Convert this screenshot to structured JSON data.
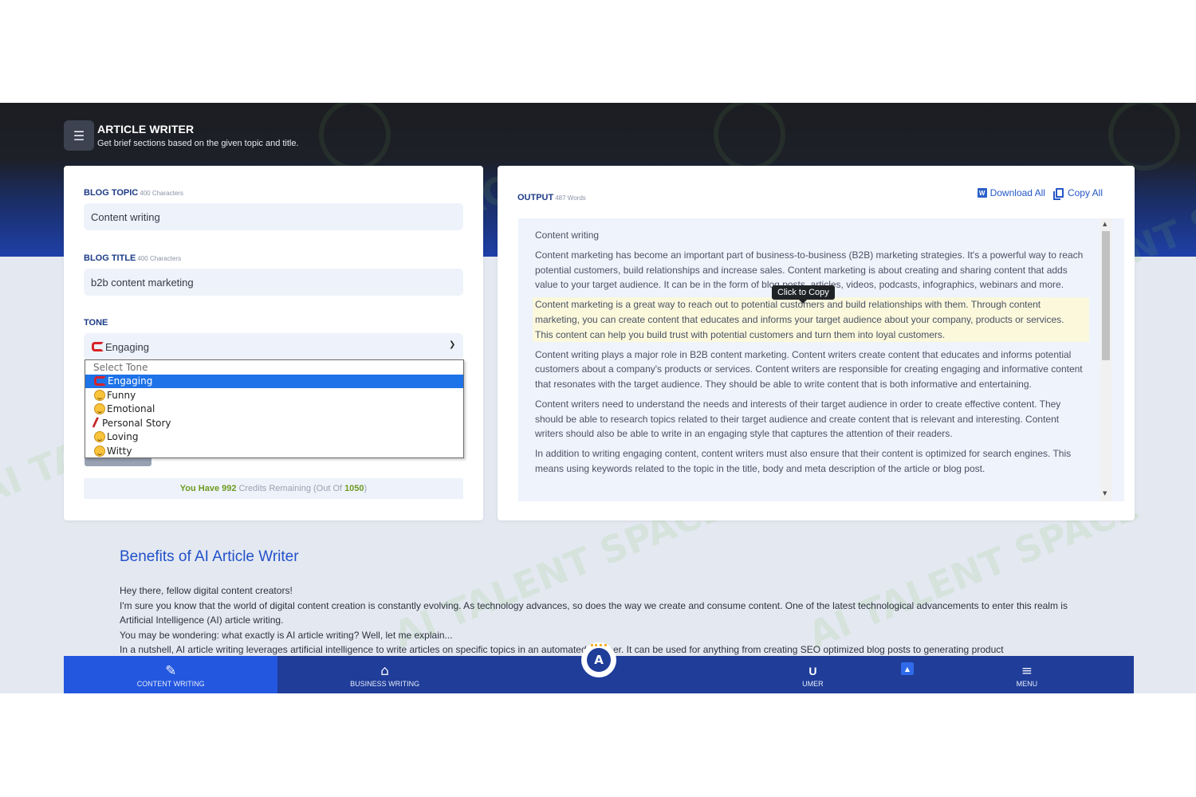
{
  "header": {
    "title": "ARTICLE WRITER",
    "subtitle": "Get brief sections based on the given topic and title.",
    "icon": "article-list-icon"
  },
  "form": {
    "blog_topic": {
      "label": "BLOG TOPIC",
      "hint": "400 Characters",
      "value": "Content writing"
    },
    "blog_title": {
      "label": "BLOG TITLE",
      "hint": "400 Characters",
      "value": "b2b content marketing"
    },
    "tone": {
      "label": "TONE",
      "selected": "Engaging",
      "options": [
        {
          "label": "Select Tone",
          "icon": ""
        },
        {
          "label": "Engaging",
          "icon": "magnet-emoji"
        },
        {
          "label": "Funny",
          "icon": "grinning-face-emoji"
        },
        {
          "label": "Emotional",
          "icon": "sad-face-emoji"
        },
        {
          "label": "Personal Story",
          "icon": "writing-hand-emoji"
        },
        {
          "label": "Loving",
          "icon": "heart-eyes-emoji"
        },
        {
          "label": "Witty",
          "icon": "smirk-face-emoji"
        }
      ]
    },
    "credits": {
      "prefix": "You Have",
      "remaining": "992",
      "middle": "Credits Remaining (Out Of",
      "total": "1050",
      "suffix": ")"
    }
  },
  "output": {
    "label": "OUTPUT",
    "hint": "487 Words",
    "download_label": "Download All",
    "copy_label": "Copy All",
    "tooltip": "Click to Copy",
    "paragraphs": [
      "Content writing",
      "Content marketing has become an important part of business-to-business (B2B) marketing strategies. It's a powerful way to reach potential customers, build relationships and increase sales. Content marketing is about creating and sharing content that adds value to your target audience. It can be in the form of blog posts, articles, videos, podcasts, infographics, webinars and more.",
      "Content marketing is a great way to reach out to potential customers and build relationships with them. Through content marketing, you can create content that educates and informs your target audience about your company, products or services. This content can help you build trust with potential customers and turn them into loyal customers.",
      "Content writing plays a major role in B2B content marketing. Content writers create content that educates and informs potential customers about a company's products or services. Content writers are responsible for creating engaging and informative content that resonates with the target audience. They should be able to write content that is both informative and entertaining.",
      "Content writers need to understand the needs and interests of their target audience in order to create effective content. They should be able to research topics related to their target audience and create content that is relevant and interesting. Content writers should also be able to write in an engaging style that captures the attention of their readers.",
      "In addition to writing engaging content, content writers must also ensure that their content is optimized for search engines. This means using keywords related to the topic in the title, body and meta description of the article or blog post."
    ]
  },
  "benefits": {
    "title": "Benefits of AI Article Writer",
    "lines": [
      "Hey there, fellow digital content creators!",
      "I'm sure you know that the world of digital content creation is constantly evolving. As technology advances, so does the way we create and consume content. One of the latest technological advancements to enter this realm is Artificial Intelligence (AI) article writing.",
      "You may be wondering: what exactly is AI article writing? Well, let me explain...",
      "In a nutshell, AI article writing leverages artificial intelligence to write articles on specific topics in an automated manner. It can be used for anything from creating SEO optimized blog posts to generating product"
    ]
  },
  "watermark": "AI TALENT SPACE",
  "nav": {
    "items": [
      {
        "label": "CONTENT WRITING",
        "icon": "feather-pen-icon"
      },
      {
        "label": "BUSINESS WRITING",
        "icon": "bank-building-icon"
      },
      {
        "label": "",
        "icon": ""
      },
      {
        "label": "UMER",
        "icon": "user-initial-icon",
        "initial": "U"
      },
      {
        "label": "MENU",
        "icon": "hamburger-menu-icon"
      }
    ]
  },
  "colors": {
    "header_bg": "#1d2027",
    "brand_blue": "#1f3d99",
    "active_blue": "#2357e0",
    "accent_link": "#2557c7",
    "credits_green": "#6e9b22"
  }
}
